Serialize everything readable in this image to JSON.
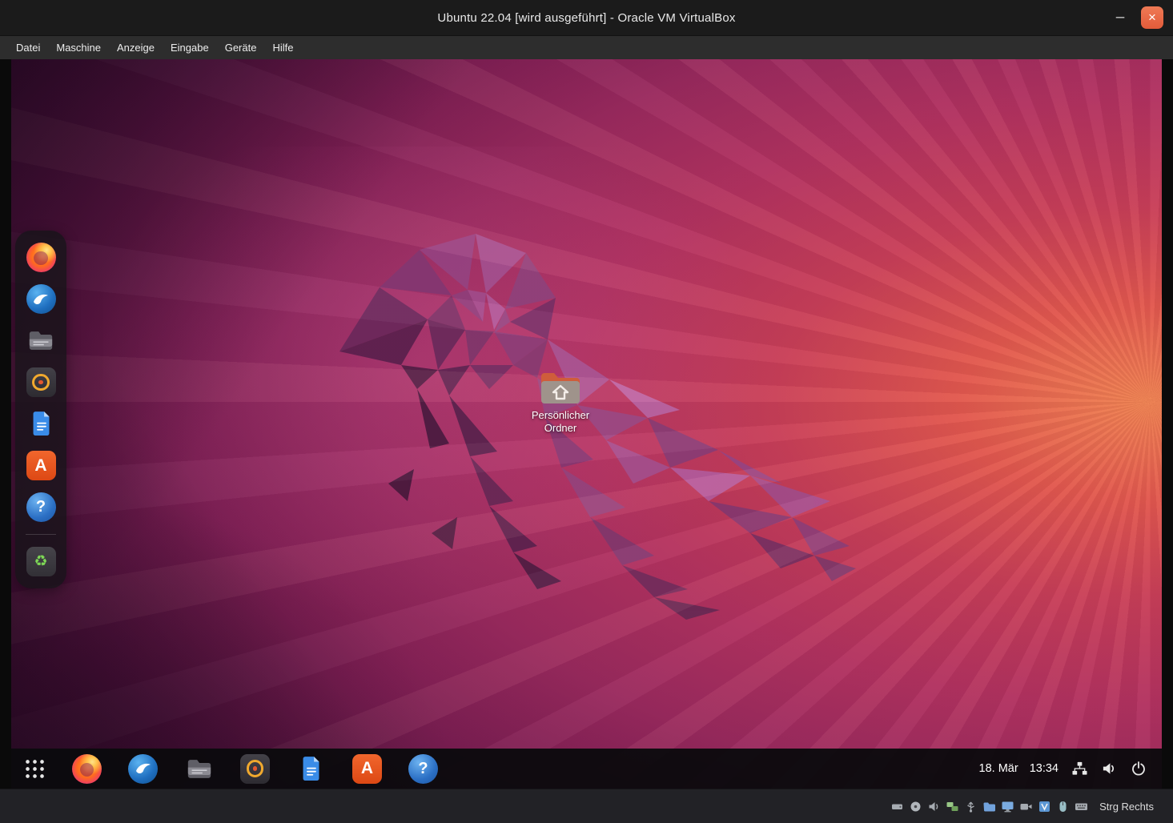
{
  "window": {
    "title": "Ubuntu 22.04 [wird ausgeführt] - Oracle VM VirtualBox",
    "controls": {
      "minimize": "–",
      "close": "×"
    }
  },
  "menubar": {
    "items": [
      {
        "label": "Datei"
      },
      {
        "label": "Maschine"
      },
      {
        "label": "Anzeige"
      },
      {
        "label": "Eingabe"
      },
      {
        "label": "Geräte"
      },
      {
        "label": "Hilfe"
      }
    ]
  },
  "desktop": {
    "wallpaper": "ubuntu-22.04-jammy-jellyfish",
    "home_icon": {
      "label": "Persönlicher Ordner"
    }
  },
  "dock": {
    "items": [
      "firefox",
      "thunderbird",
      "files",
      "rhythmbox",
      "libreoffice-writer",
      "app-center",
      "help",
      "trash"
    ]
  },
  "icons": {
    "app_center_glyph": "A",
    "help_glyph": "?",
    "trash_glyph": "♻"
  },
  "panel": {
    "launchers": [
      "app-grid",
      "firefox",
      "thunderbird",
      "files",
      "rhythmbox",
      "libreoffice-writer",
      "app-center",
      "help"
    ],
    "clock": {
      "date": "18. Mär",
      "time": "13:34"
    },
    "system_icons": [
      "network",
      "volume",
      "power"
    ]
  },
  "statusbar": {
    "device_icons": [
      "hard-disks",
      "optical-drives",
      "audio",
      "network",
      "usb",
      "shared-folders",
      "display",
      "recording",
      "features",
      "mouse-integration",
      "keyboard"
    ],
    "host_key": "Strg Rechts"
  },
  "colors": {
    "ubuntu_orange": "#e95420",
    "titlebar_bg": "#1b1b1b",
    "menubar_bg": "#2d2d2d",
    "panel_bg": "#0b0a0e",
    "statusbar_bg": "#222226"
  }
}
